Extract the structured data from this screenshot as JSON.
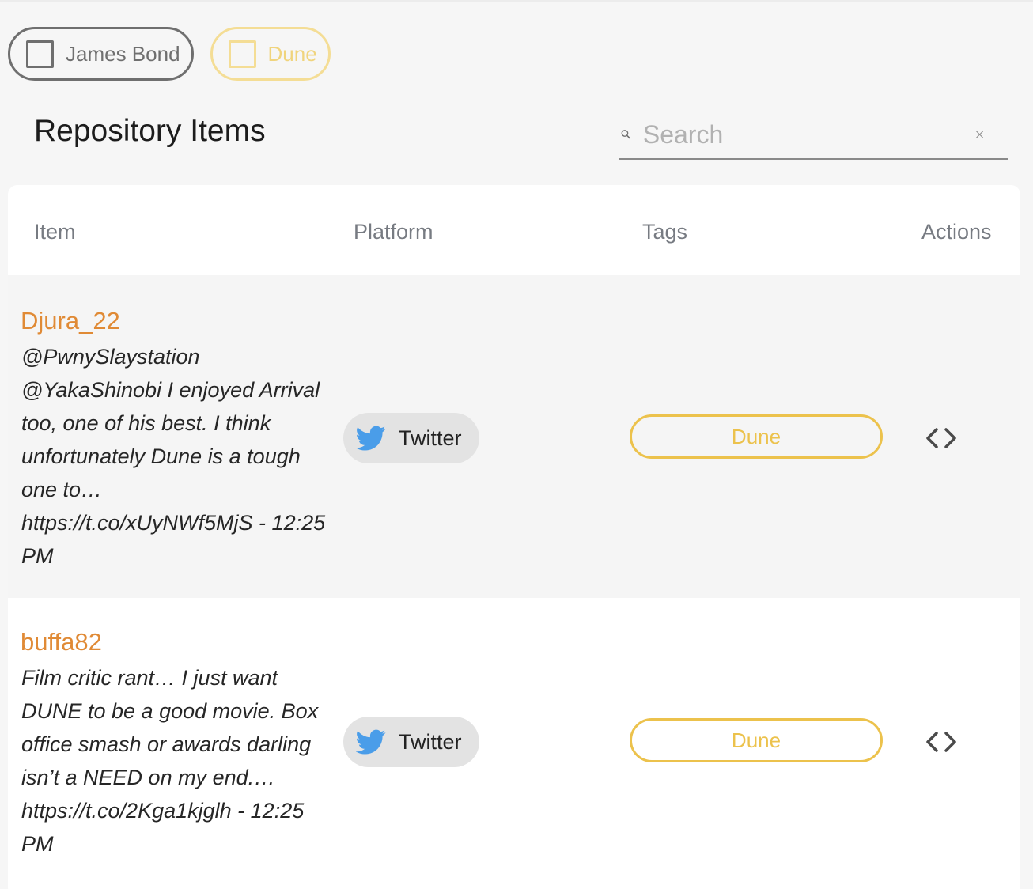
{
  "filters": [
    {
      "label": "James Bond",
      "checked": false,
      "color": "#6f6f6f"
    },
    {
      "label": "Dune",
      "checked": false,
      "color": "#f0d47d"
    }
  ],
  "header": {
    "title": "Repository Items",
    "search_placeholder": "Search",
    "search_value": ""
  },
  "table": {
    "columns": [
      "Item",
      "Platform",
      "Tags",
      "Actions"
    ],
    "rows": [
      {
        "author": "Djura_22",
        "text": "@PwnySlaystation @YakaShinobi I enjoyed Arrival too, one of his best. I think unfortunately Dune is a tough one to… https://t.co/xUyNWf5MjS - 12:25 PM",
        "platform": "Twitter",
        "tag": "Dune"
      },
      {
        "author": "buffa82",
        "text": "Film critic rant… I just want DUNE to be a good movie. Box office smash or awards darling isn’t a NEED on my end.… https://t.co/2Kga1kjglh - 12:25 PM",
        "platform": "Twitter",
        "tag": "Dune"
      }
    ]
  },
  "colors": {
    "author": "#e08a35",
    "tag": "#ecc24c",
    "twitter": "#4a9de9"
  }
}
